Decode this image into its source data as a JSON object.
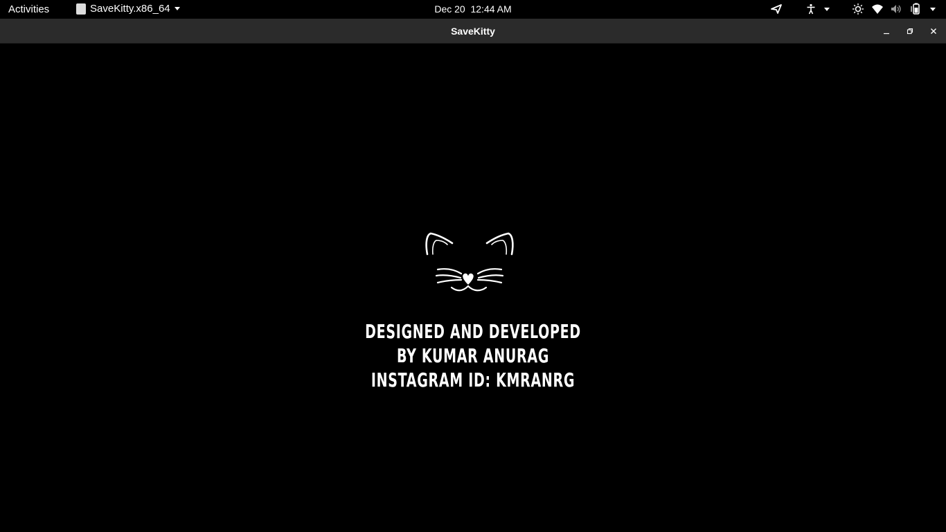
{
  "topbar": {
    "activities_label": "Activities",
    "app_name": "SaveKitty.x86_64",
    "date": "Dec 20",
    "time": "12:44 AM",
    "tray_icons": [
      "send-icon",
      "accessibility-icon",
      "brightness-icon",
      "wifi-icon",
      "volume-muted-icon",
      "battery-icon"
    ]
  },
  "window": {
    "title": "SaveKitty"
  },
  "splash": {
    "line1": "DESIGNED AND DEVELOPED",
    "line2": "BY KUMAR ANURAG",
    "line3": "INSTAGRAM ID: KMRANRG"
  },
  "colors": {
    "background": "#000000",
    "titlebar": "#2b2b2b",
    "text": "#ffffff"
  }
}
